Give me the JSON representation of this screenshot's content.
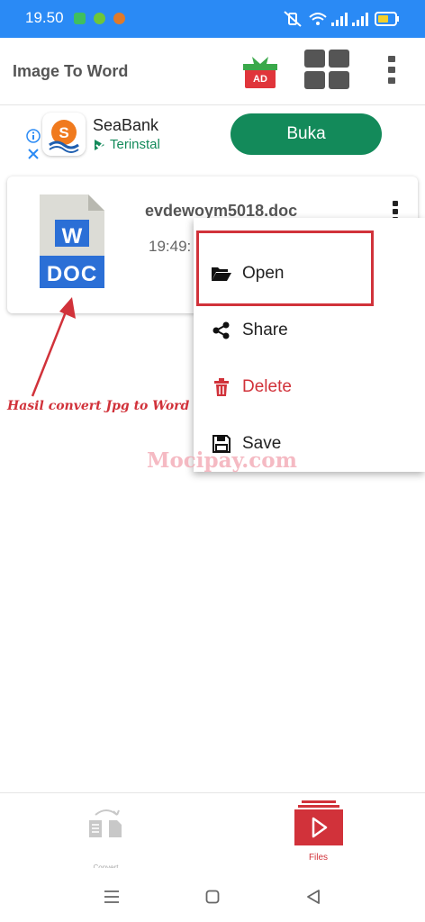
{
  "status_bar": {
    "time": "19.50"
  },
  "app_bar": {
    "title": "Image To Word",
    "ad_badge": "AD"
  },
  "ad_banner": {
    "advertiser": "SeaBank",
    "installed_label": "Terinstal",
    "cta_label": "Buka"
  },
  "file_card": {
    "file_name": "evdewoym5018.doc",
    "time": "19:49:",
    "icon_letter": "W",
    "icon_label": "DOC"
  },
  "context_menu": {
    "items": [
      {
        "label": "Open",
        "icon": "folder-open-icon"
      },
      {
        "label": "Share",
        "icon": "share-icon"
      },
      {
        "label": "Delete",
        "icon": "trash-icon"
      },
      {
        "label": "Save",
        "icon": "floppy-disk-icon"
      }
    ]
  },
  "annotation": {
    "caption": "Hasil convert Jpg to Word",
    "watermark": "Mocipay.com"
  },
  "bottom_nav": {
    "tabs": [
      {
        "label": "Convert"
      },
      {
        "label": "Files"
      }
    ]
  },
  "colors": {
    "status_bar": "#2a8af5",
    "accent_red": "#d1323a",
    "cta_green": "#138a5a",
    "word_blue": "#2b6fd6"
  }
}
